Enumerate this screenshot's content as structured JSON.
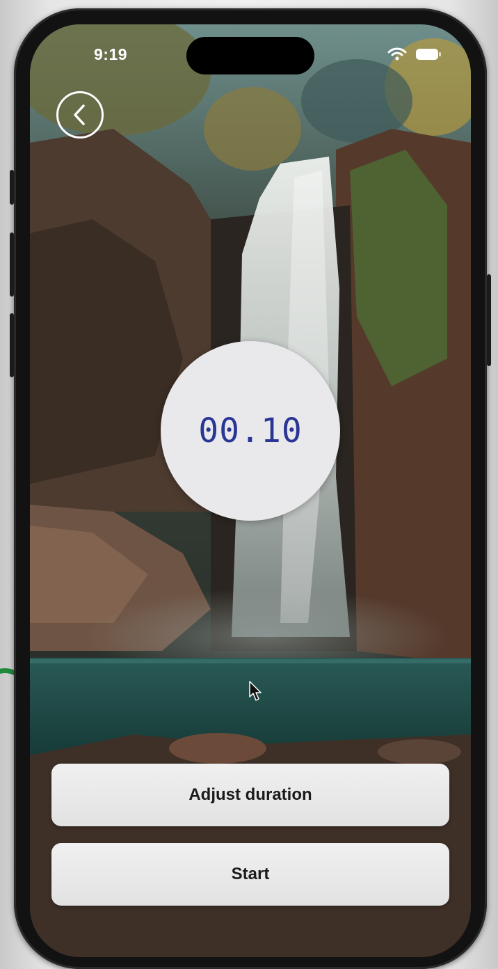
{
  "status_bar": {
    "time": "9:19",
    "icons": [
      "wifi-icon",
      "battery-icon"
    ]
  },
  "nav": {
    "back_icon": "chevron-left-icon"
  },
  "timer": {
    "display": "00.10",
    "color": "#2a3694"
  },
  "buttons": {
    "adjust_duration": "Adjust duration",
    "start": "Start"
  },
  "background": {
    "scene": "waterfall-illustration"
  },
  "colors": {
    "button_bg": "#e6e6e6",
    "button_text": "#1b1b1b",
    "timer_circle": "#e9e9ec"
  }
}
